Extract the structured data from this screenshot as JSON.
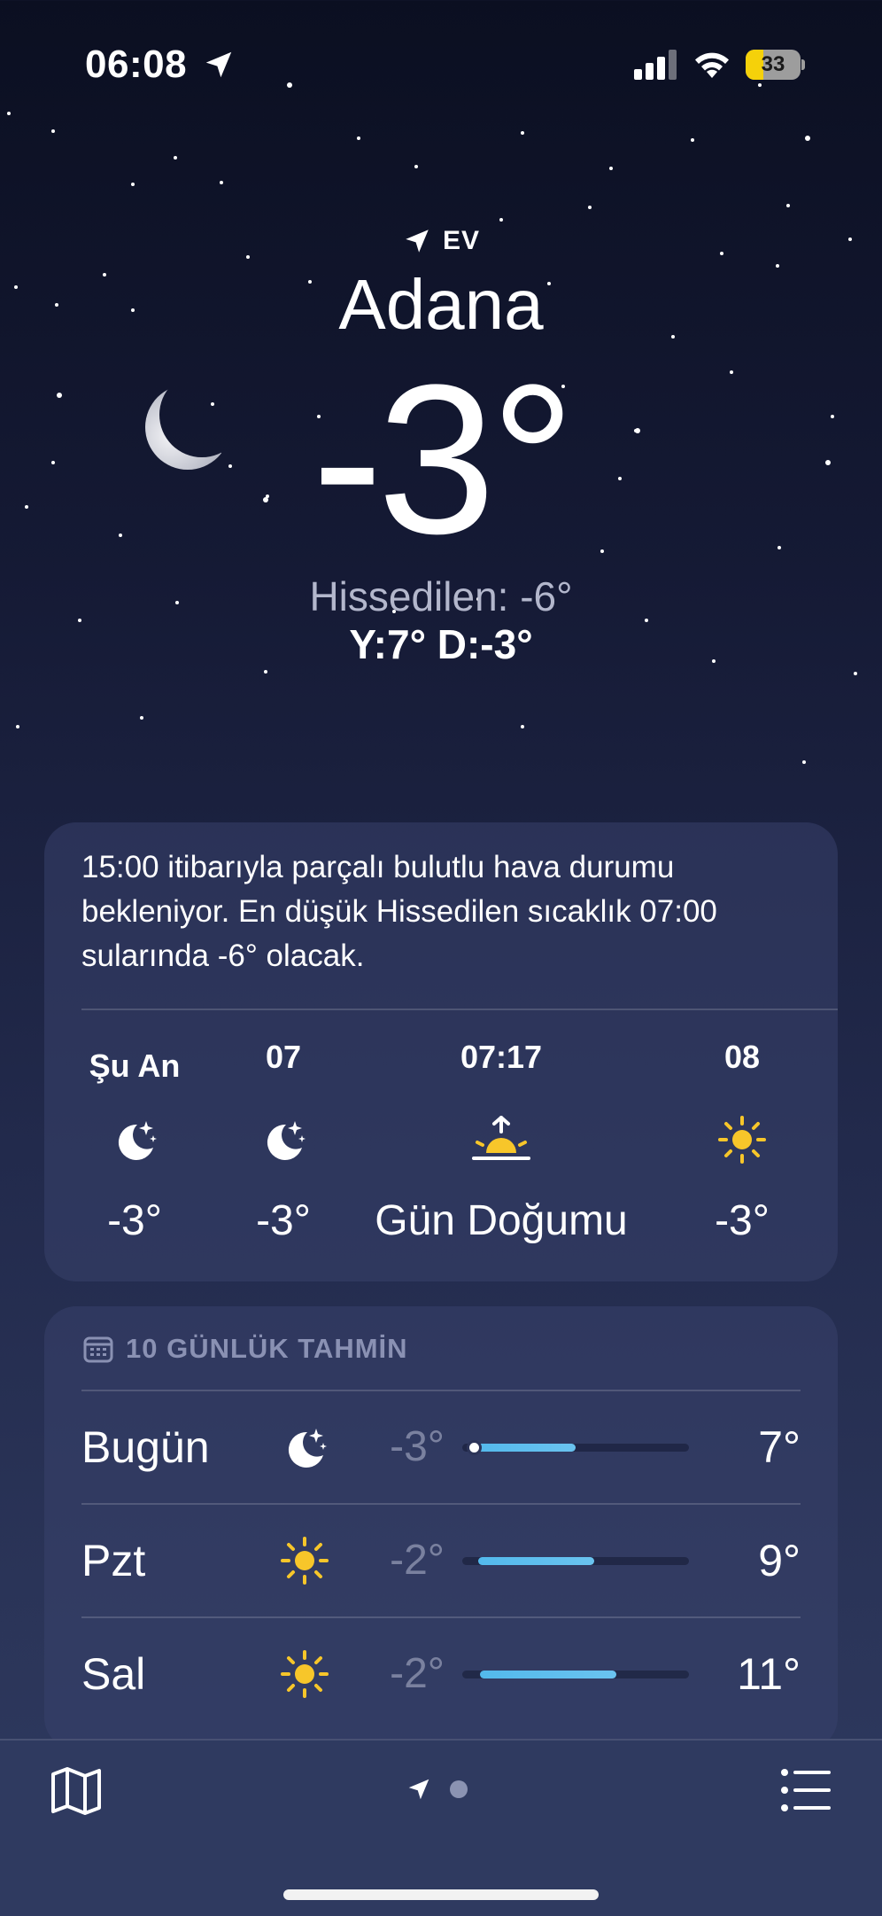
{
  "status_bar": {
    "time": "06:08",
    "battery": "33",
    "battery_level": 0.33
  },
  "location": {
    "label": "EV",
    "city": "Adana",
    "temperature": "-3°",
    "feels_like": "Hissedilen: -6°",
    "high_low": "Y:7° D:-3°"
  },
  "hourly": {
    "summary": "15:00 itibarıyla parçalı bulutlu hava durumu bekleniyor. En düşük Hissedilen sıcaklık 07:00 sularında -6° olacak.",
    "items": [
      {
        "time": "Şu An",
        "icon": "moon-stars-icon",
        "value": "-3°"
      },
      {
        "time": "07",
        "icon": "moon-stars-icon",
        "value": "-3°"
      },
      {
        "time": "07:17",
        "icon": "sunrise-icon",
        "value": "Gün Doğumu"
      },
      {
        "time": "08",
        "icon": "sun-icon",
        "value": "-3°"
      }
    ]
  },
  "daily": {
    "title": "10 GÜNLÜK TAHMİN",
    "days": [
      {
        "day": "Bugün",
        "icon": "moon-stars-icon",
        "low": "-3°",
        "high": "7°",
        "range_start": 0.05,
        "range_end": 0.5,
        "current_dot": 0.05
      },
      {
        "day": "Pzt",
        "icon": "sun-icon",
        "low": "-2°",
        "high": "9°",
        "range_start": 0.07,
        "range_end": 0.58
      },
      {
        "day": "Sal",
        "icon": "sun-icon",
        "low": "-2°",
        "high": "11°",
        "range_start": 0.08,
        "range_end": 0.68
      }
    ]
  },
  "colors": {
    "sun": "#f7c62a",
    "temp_bar": "#5bbdee",
    "battery": "#f5d10a"
  }
}
